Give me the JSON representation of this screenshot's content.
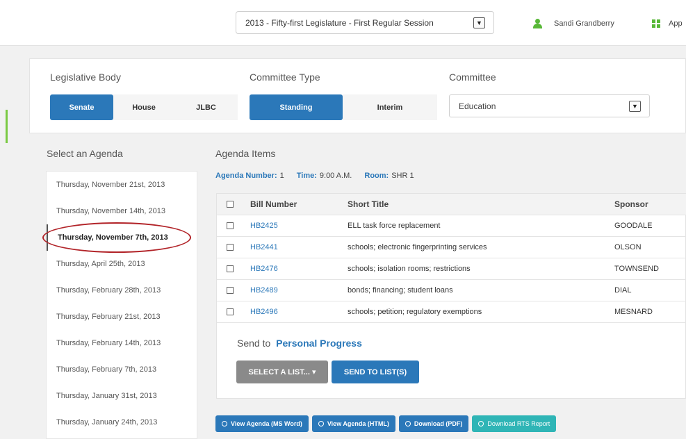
{
  "header": {
    "session_select": "2013 - Fifty-first Legislature - First Regular Session",
    "user_name": "Sandi Grandberry",
    "apps_label": "App"
  },
  "filters": {
    "legislative_body_label": "Legislative Body",
    "legislative_body_options": [
      "Senate",
      "House",
      "JLBC"
    ],
    "legislative_body_selected": "Senate",
    "committee_type_label": "Committee Type",
    "committee_type_options": [
      "Standing",
      "Interim"
    ],
    "committee_type_selected": "Standing",
    "committee_label": "Committee",
    "committee_value": "Education"
  },
  "agenda": {
    "title": "Select an Agenda",
    "dates": [
      "Thursday, November 21st, 2013",
      "Thursday, November 14th, 2013",
      "Thursday, November 7th, 2013",
      "Thursday, April 25th, 2013",
      "Thursday, February 28th, 2013",
      "Thursday, February 21st, 2013",
      "Thursday, February 14th, 2013",
      "Thursday, February 7th, 2013",
      "Thursday, January 31st, 2013",
      "Thursday, January 24th, 2013"
    ],
    "selected": "Thursday, November 7th, 2013"
  },
  "items": {
    "title": "Agenda Items",
    "agenda_number_label": "Agenda Number:",
    "agenda_number": "1",
    "time_label": "Time:",
    "time": "9:00 A.M.",
    "room_label": "Room:",
    "room": "SHR 1",
    "columns": [
      "Bill Number",
      "Short Title",
      "Sponsor"
    ],
    "rows": [
      {
        "bill": "HB2425",
        "title": "ELL task force replacement",
        "sponsor": "GOODALE"
      },
      {
        "bill": "HB2441",
        "title": "schools; electronic fingerprinting services",
        "sponsor": "OLSON"
      },
      {
        "bill": "HB2476",
        "title": "schools; isolation rooms; restrictions",
        "sponsor": "TOWNSEND"
      },
      {
        "bill": "HB2489",
        "title": "bonds; financing; student loans",
        "sponsor": "DIAL"
      },
      {
        "bill": "HB2496",
        "title": "schools; petition; regulatory exemptions",
        "sponsor": "MESNARD"
      }
    ],
    "send_to_label": "Send to",
    "send_to_target": "Personal Progress",
    "select_list_label": "SELECT A LIST... ▾",
    "send_to_lists_label": "SEND TO LIST(S)"
  },
  "actions": {
    "view_word": "View Agenda (MS Word)",
    "view_html": "View Agenda (HTML)",
    "download_pdf": "Download (PDF)",
    "download_rts": "Download RTS Report"
  },
  "colors": {
    "primary": "#2b78b9",
    "accent_green": "#58b837",
    "teal": "#2fb5b6",
    "highlight_circle": "#b22429"
  }
}
